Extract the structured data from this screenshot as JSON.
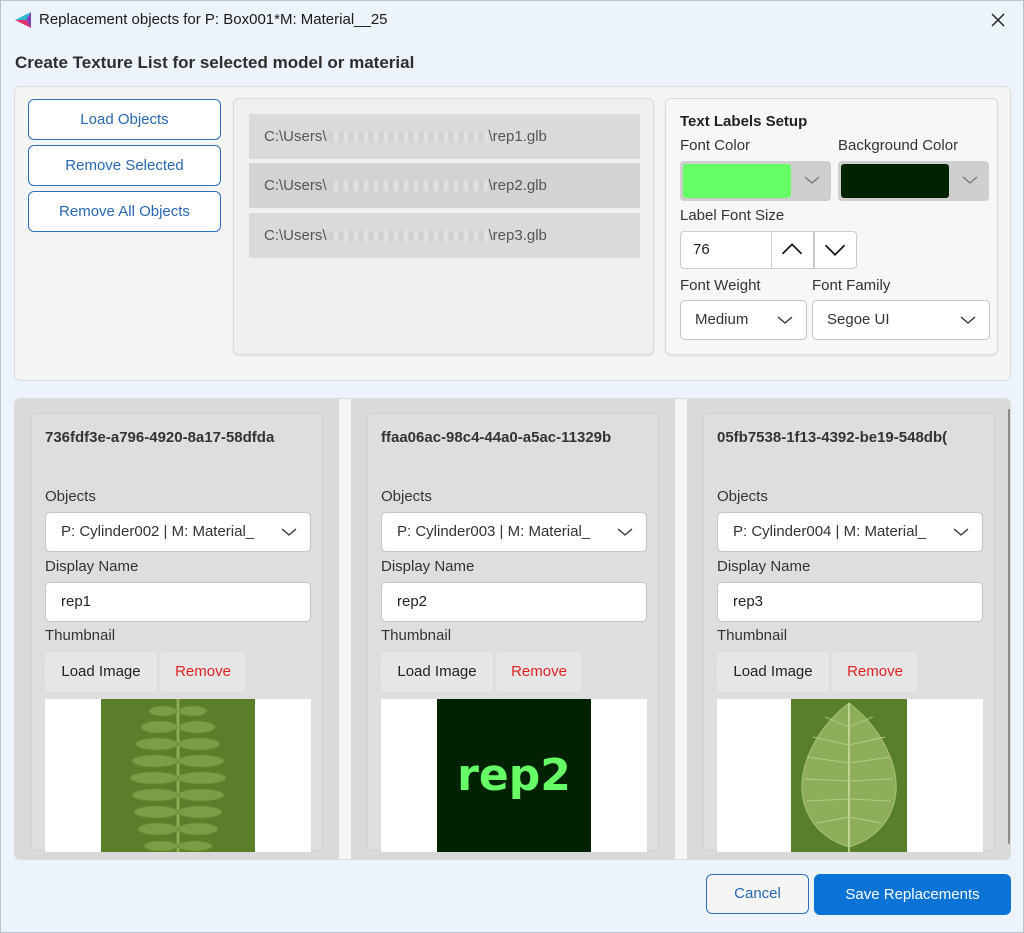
{
  "window": {
    "title": "Replacement objects for P: Box001*M: Material__25",
    "heading": "Create Texture List for selected model or material"
  },
  "actions": {
    "load_objects": "Load Objects",
    "remove_selected": "Remove Selected",
    "remove_all": "Remove All Objects"
  },
  "files": [
    {
      "prefix": "C:\\Users\\",
      "suffix": "\\rep1.glb"
    },
    {
      "prefix": "C:\\Users\\",
      "suffix": "\\rep2.glb"
    },
    {
      "prefix": "C:\\Users\\",
      "suffix": "\\rep3.glb"
    }
  ],
  "labels_setup": {
    "title": "Text Labels Setup",
    "font_color_label": "Font Color",
    "background_color_label": "Background Color",
    "font_color": "#66ff66",
    "background_color": "#002200",
    "font_size_label": "Label Font Size",
    "font_size": "76",
    "font_weight_label": "Font Weight",
    "font_weight": "Medium",
    "font_family_label": "Font Family",
    "font_family": "Segoe UI"
  },
  "cards": [
    {
      "id": "736fdf3e-a796-4920-8a17-58dfda",
      "objects_label": "Objects",
      "object": "P: Cylinder002 | M: Material_",
      "display_name_label": "Display Name",
      "display_name": "rep1",
      "thumbnail_label": "Thumbnail",
      "load_image": "Load Image",
      "remove": "Remove",
      "thumb_kind": "fern-leaf"
    },
    {
      "id": "ffaa06ac-98c4-44a0-a5ac-11329b",
      "objects_label": "Objects",
      "object": "P: Cylinder003 | M: Material_",
      "display_name_label": "Display Name",
      "display_name": "rep2",
      "thumbnail_label": "Thumbnail",
      "load_image": "Load Image",
      "remove": "Remove",
      "thumb_kind": "text-label",
      "thumb_text": "rep2"
    },
    {
      "id": "05fb7538-1f13-4392-be19-548db(",
      "objects_label": "Objects",
      "object": "P: Cylinder004 | M: Material_",
      "display_name_label": "Display Name",
      "display_name": "rep3",
      "thumbnail_label": "Thumbnail",
      "load_image": "Load Image",
      "remove": "Remove",
      "thumb_kind": "broad-leaf"
    }
  ],
  "footer": {
    "cancel": "Cancel",
    "save": "Save Replacements"
  },
  "colors": {
    "accent": "#0a74d6",
    "remove_text": "#e02020",
    "leaf_bg": "#5a7e2a"
  }
}
